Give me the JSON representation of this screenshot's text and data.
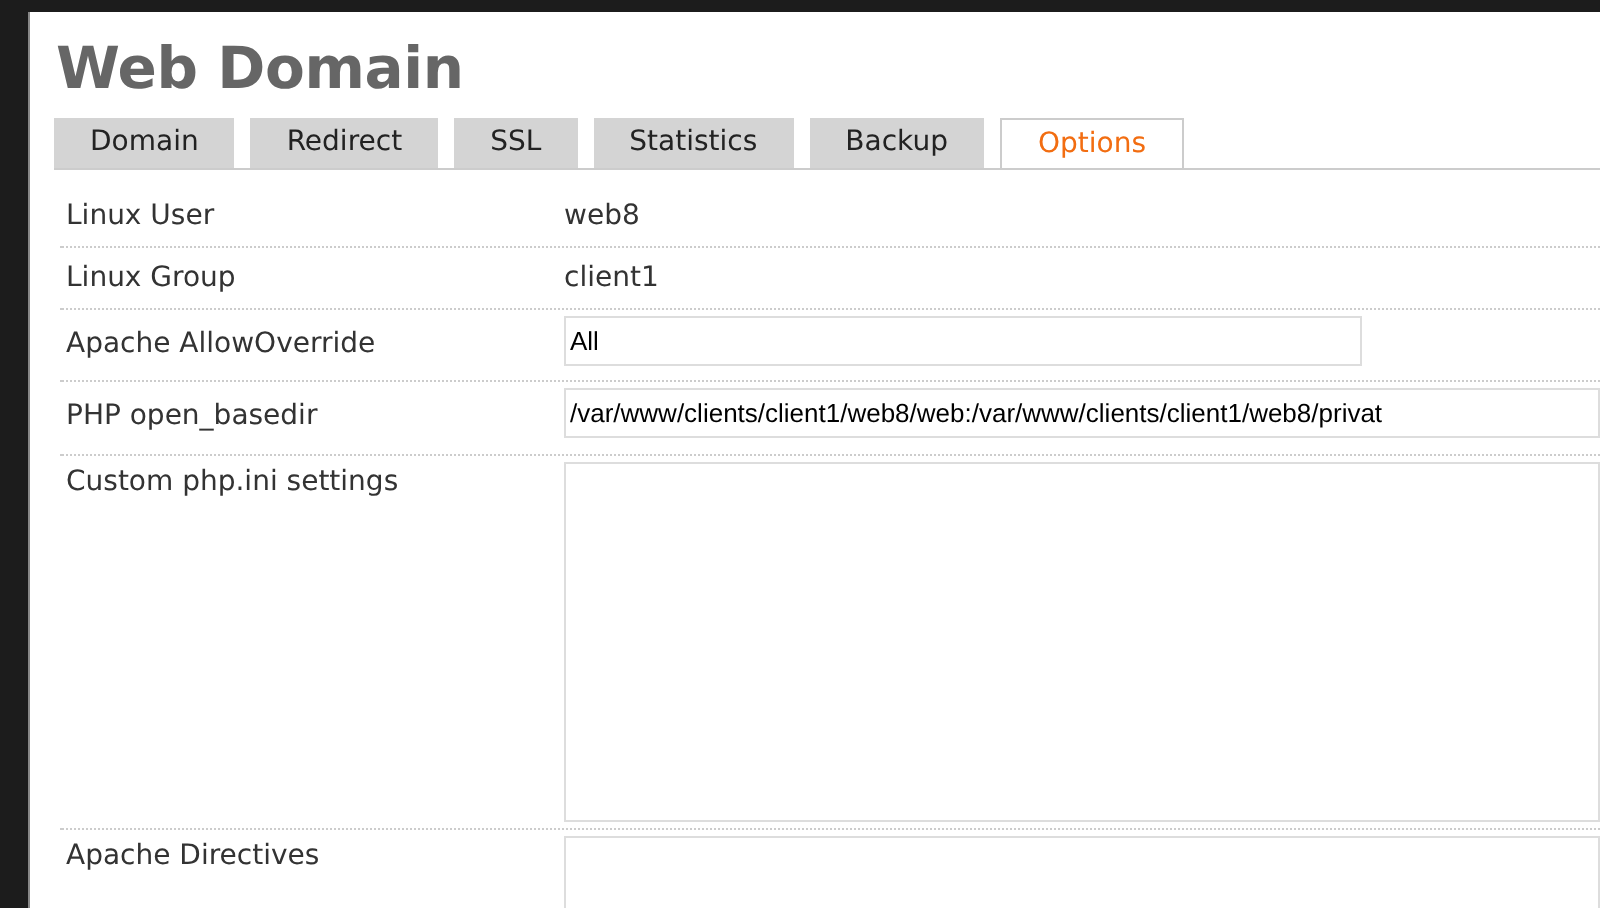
{
  "page": {
    "title": "Web Domain"
  },
  "tabs": [
    {
      "label": "Domain",
      "selected": false
    },
    {
      "label": "Redirect",
      "selected": false
    },
    {
      "label": "SSL",
      "selected": false
    },
    {
      "label": "Statistics",
      "selected": false
    },
    {
      "label": "Backup",
      "selected": false
    },
    {
      "label": "Options",
      "selected": true
    }
  ],
  "form": [
    {
      "kind": "text",
      "label": "Linux User",
      "value": "web8"
    },
    {
      "kind": "text",
      "label": "Linux Group",
      "value": "client1"
    },
    {
      "kind": "input",
      "label": "Apache AllowOverride",
      "value": "All"
    },
    {
      "kind": "wideinput",
      "label": "PHP open_basedir",
      "value": "/var/www/clients/client1/web8/web:/var/www/clients/client1/web8/privat"
    },
    {
      "kind": "textarea",
      "label": "Custom php.ini settings"
    },
    {
      "kind": "textarea2",
      "label": "Apache Directives"
    }
  ]
}
